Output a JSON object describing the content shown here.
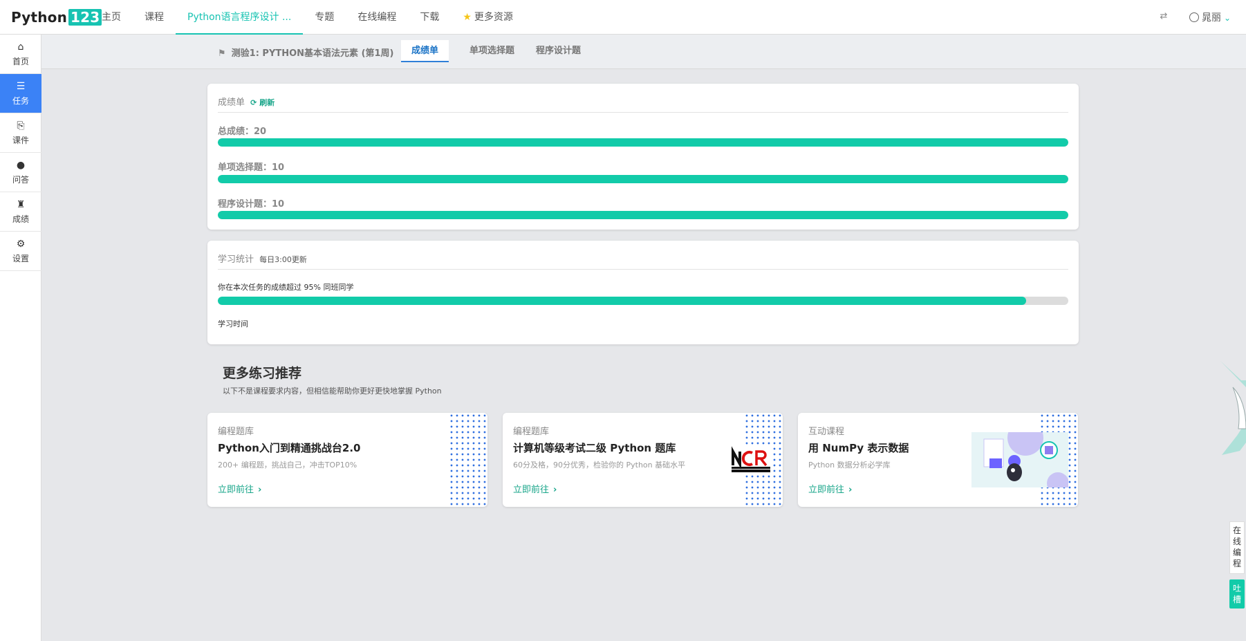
{
  "topbar": {
    "logo_text": "Python",
    "logo_num": "123",
    "nav": [
      {
        "label": "主页"
      },
      {
        "label": "课程"
      },
      {
        "label": "Python语言程序设计 ..."
      },
      {
        "label": "专题"
      },
      {
        "label": "在线编程"
      },
      {
        "label": "下载"
      },
      {
        "label": "更多资源"
      }
    ],
    "user": "晁丽"
  },
  "sidebar": {
    "items": [
      {
        "label": "首页",
        "icon": "home-icon"
      },
      {
        "label": "任务",
        "icon": "tasks-icon"
      },
      {
        "label": "课件",
        "icon": "paperclip-icon"
      },
      {
        "label": "问答",
        "icon": "comments-icon"
      },
      {
        "label": "成绩",
        "icon": "trophy-icon"
      },
      {
        "label": "设置",
        "icon": "gear-icon"
      }
    ]
  },
  "subnav": {
    "quiz_title": "测验1: PYTHON基本语法元素 (第1周)",
    "tabs": [
      {
        "label": "成绩单"
      },
      {
        "label": "单项选择题"
      },
      {
        "label": "程序设计题"
      }
    ]
  },
  "scores": {
    "title": "成绩单",
    "refresh": "刷新",
    "total_label": "总成绩：20",
    "choice_label": "单项选择题：10",
    "program_label": "程序设计题：10",
    "total_fraction": 1.0,
    "choice_fraction": 1.0,
    "program_fraction": 1.0
  },
  "stats": {
    "title": "学习统计",
    "update_note": "每日3:00更新",
    "rank_text": "你在本次任务的成绩超过 95% 同班同学",
    "rank_fraction": 0.95,
    "time_label": "学习时间"
  },
  "recommend": {
    "title": "更多练习推荐",
    "subtitle": "以下不是课程要求内容，但相信能帮助你更好更快地掌握 Python",
    "cards": [
      {
        "category": "编程题库",
        "title": "Python入门到精通挑战台2.0",
        "desc": "200+ 编程题，挑战自己，冲击TOP10%",
        "link": "立即前往"
      },
      {
        "category": "编程题库",
        "title": "计算机等级考试二级 Python 题库",
        "desc": "60分及格，90分优秀，检验你的 Python 基础水平",
        "link": "立即前往"
      },
      {
        "category": "互动课程",
        "title": "用 NumPy 表示数据",
        "desc": "Python 数据分析必学库",
        "link": "立即前往"
      }
    ]
  },
  "floating": {
    "online_code": "在线编程",
    "feedback": "吐槽"
  },
  "colors": {
    "accent": "#17c3b2",
    "progress": "#12cba9",
    "active_blue": "#3b82f6"
  }
}
